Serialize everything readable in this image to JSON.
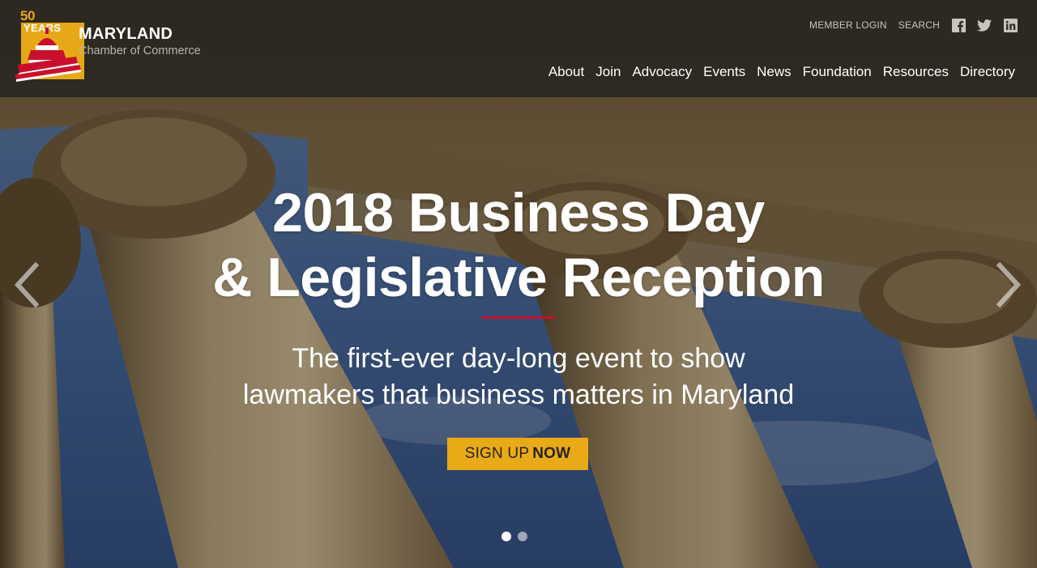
{
  "brand": {
    "anniversary_number": "50",
    "anniversary_word": "YEARS",
    "name": "MARYLAND",
    "subtitle": "Chamber of Commerce",
    "gold": "#e6a817",
    "red": "#c8102e"
  },
  "utility_nav": {
    "member_login": "MEMBER LOGIN",
    "search": "SEARCH",
    "social_icons": [
      "facebook-icon",
      "twitter-icon",
      "linkedin-icon"
    ]
  },
  "main_nav": [
    {
      "label": "About"
    },
    {
      "label": "Join"
    },
    {
      "label": "Advocacy"
    },
    {
      "label": "Events"
    },
    {
      "label": "News"
    },
    {
      "label": "Foundation"
    },
    {
      "label": "Resources"
    },
    {
      "label": "Directory"
    }
  ],
  "hero": {
    "headline_line1": "2018 Business Day",
    "headline_line2": "& Legislative Reception",
    "subhead_line1": "The first-ever day-long event to show",
    "subhead_line2": "lawmakers that business matters in Maryland",
    "cta_light": "SIGN UP",
    "cta_bold": "NOW",
    "cta_color": "#e8aa16",
    "slides_total": 2,
    "slide_active": 1,
    "prev_icon": "chevron-left-icon",
    "next_icon": "chevron-right-icon"
  }
}
